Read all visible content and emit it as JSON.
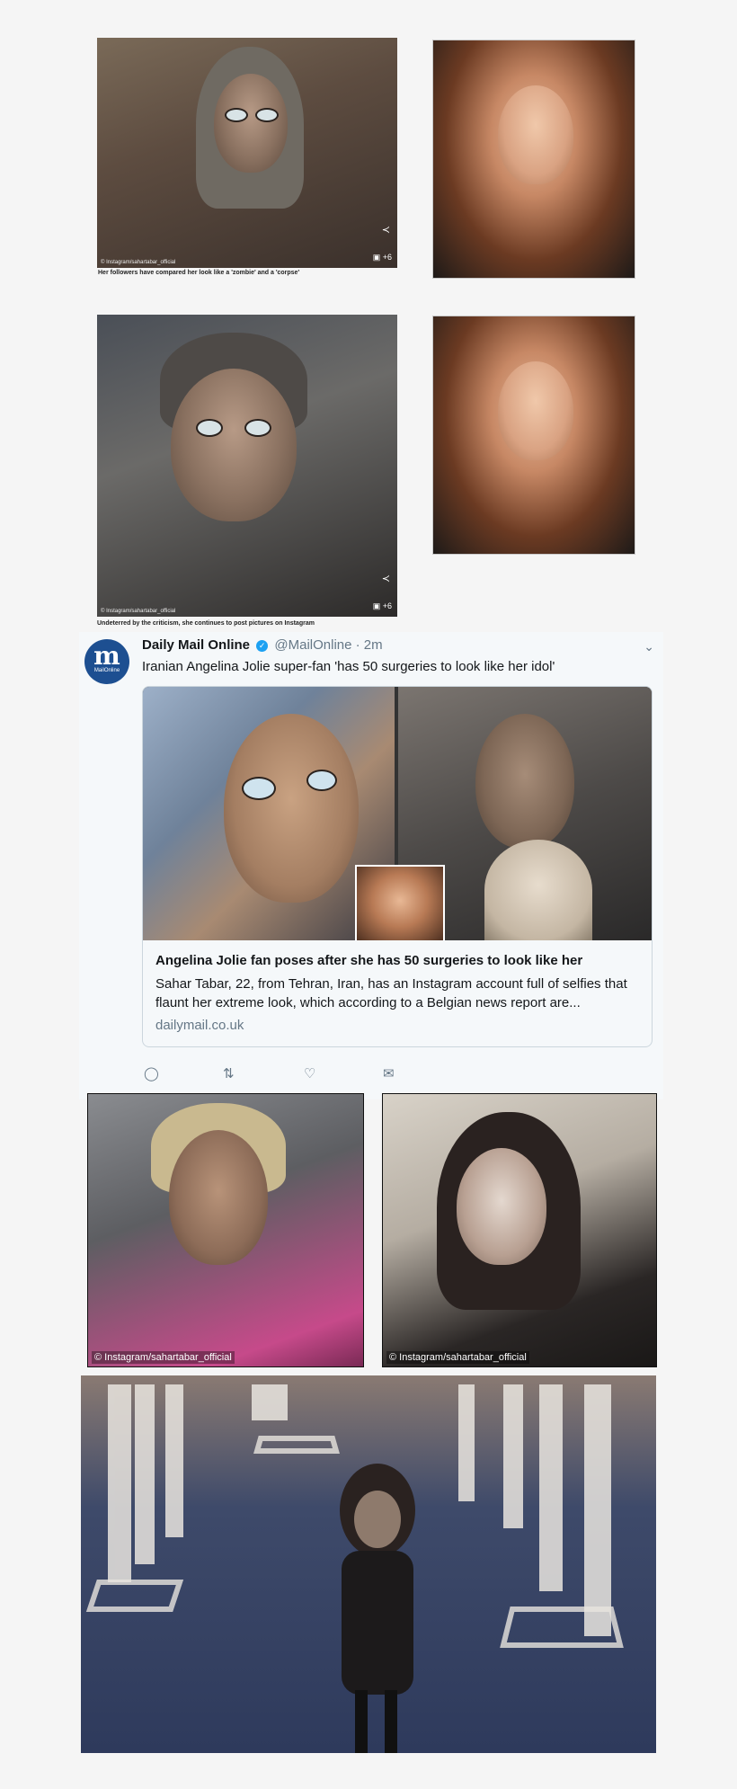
{
  "panel1": {
    "caption": "Her followers have compared her look like a 'zombie' and  a 'corpse'",
    "credit": "© Instagram/sahartabar_official",
    "photo_count": "+6"
  },
  "panel2": {
    "caption": "Undeterred by the criticism, she continues to post pictures on Instagram",
    "credit": "© Instagram/sahartabar_official",
    "photo_count": "+6"
  },
  "tweet": {
    "avatar_text": "m",
    "avatar_subtext": "MailOnline",
    "name": "Daily Mail Online",
    "handle": "@MailOnline",
    "time": "· 2m",
    "text": "Iranian Angelina Jolie super-fan 'has 50 surgeries to look like her idol'",
    "card": {
      "title": "Angelina Jolie fan poses after she has 50 surgeries to look like her",
      "description": "Sahar Tabar, 22, from Tehran, Iran, has an Instagram account full of selfies that flaunt her extreme look, which according to a Belgian news report are...",
      "domain": "dailymail.co.uk"
    },
    "actions": [
      "reply-icon",
      "retweet-icon",
      "like-icon",
      "message-icon"
    ]
  },
  "panel3": {
    "credit_left": "© Instagram/sahartabar_official",
    "credit_right": "© Instagram/sahartabar_official"
  }
}
